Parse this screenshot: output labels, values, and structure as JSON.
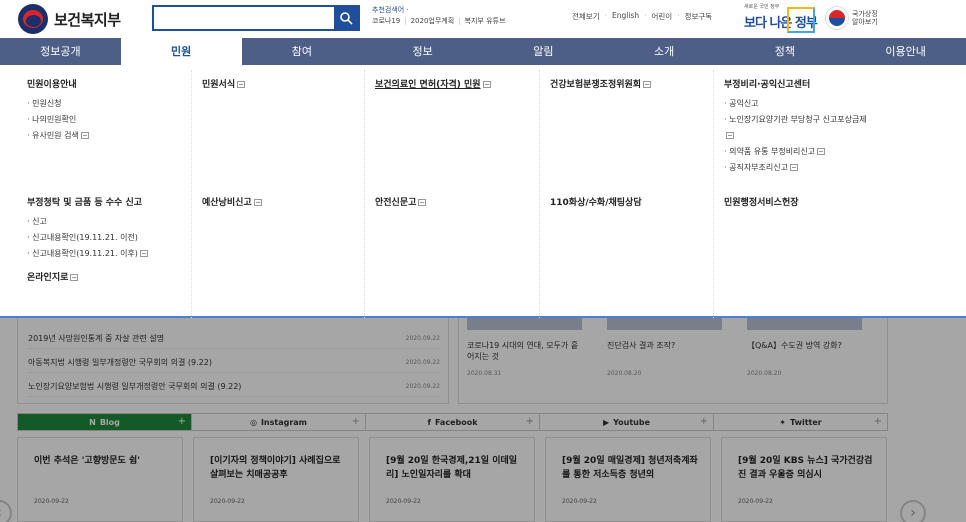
{
  "header": {
    "logo_text": "보건복지부",
    "search_placeholder": "",
    "rec_title": "추천검색어",
    "rec_items": [
      "코로나19",
      "2020업무계획",
      "복지부 유튜브"
    ],
    "top_links": [
      "전체보기",
      "English",
      "어린이",
      "정보구독"
    ],
    "gov_small": "새로운 국민 정부",
    "gov_text": "보다 나은 정부",
    "state_text": [
      "국가상징",
      "알아보기"
    ]
  },
  "nav": [
    "정보공개",
    "민원",
    "참여",
    "정보",
    "알림",
    "소개",
    "정책",
    "이용안내"
  ],
  "mega": {
    "row1": [
      {
        "title": "민원이용안내",
        "items": [
          "민원신청",
          "나의민원확인",
          "유사민원 검색"
        ]
      },
      {
        "title": "민원서식",
        "items": []
      },
      {
        "title": "보건의료인 면허(자격) 민원",
        "items": []
      },
      {
        "title": "건강보험분쟁조정위원회",
        "items": []
      },
      {
        "title": "부정비리·공익신고센터",
        "items": [
          "공익신고",
          "노인장기요양기관 부당청구 신고포상금제",
          "의약품 유통 부정비리신고",
          "공직자부조리신고"
        ]
      }
    ],
    "row2": [
      {
        "title": "부정청탁 및 금품 등 수수 신고",
        "items": [
          "신고",
          "신고내용확인(19.11.21. 이전)",
          "신고내용확인(19.11.21. 이후)"
        ],
        "extra": "온라인지로"
      },
      {
        "title": "예산낭비신고",
        "items": []
      },
      {
        "title": "안전신문고",
        "items": []
      },
      {
        "title": "110화상/수화/채팅상담",
        "items": []
      },
      {
        "title": "민원행정서비스헌장",
        "items": []
      }
    ]
  },
  "news": [
    {
      "title": "2019년 사망원인통계 중 자살 관련 설명",
      "date": "2020.09.22"
    },
    {
      "title": "아동복지법 시행령 일부개정령안 국무회의 의결 (9.22)",
      "date": "2020.09.22"
    },
    {
      "title": "노인장기요양보험법 시행령 일부개정령안 국무회의 의결 (9.22)",
      "date": "2020.09.22"
    }
  ],
  "cards": [
    {
      "title": "코로나19 시대의 연대, 모두가 흩어지는 것",
      "date": "2020.08.31"
    },
    {
      "title": "진단검사 결과 조작?",
      "date": "2020.08.20"
    },
    {
      "title": "【Q&A】수도권 방역 강화?",
      "date": "2020.08.20"
    }
  ],
  "sns": [
    {
      "label": "Blog",
      "icon": "N"
    },
    {
      "label": "Instagram",
      "icon": "◎"
    },
    {
      "label": "Facebook",
      "icon": "f"
    },
    {
      "label": "Youtube",
      "icon": "▶"
    },
    {
      "label": "Twitter",
      "icon": "✦"
    }
  ],
  "posts": [
    {
      "title": "이번 추석은 '고향방문도 쉼'",
      "date": "2020-09-22"
    },
    {
      "title": "[이기자의 정책이야기] 사례집으로 살펴보는 치매공공후",
      "date": "2020-09-22"
    },
    {
      "title": "[9월 20일 한국경제,21일 이데일리] 노인일자리를 확대",
      "date": "2020-09-22"
    },
    {
      "title": "[9월 20일 매일경제] 청년저축계좌를 통한 저소득층 청년의",
      "date": "2020-09-22"
    },
    {
      "title": "[9월 20일 KBS 뉴스] 국가건강검진 결과 우울증 의심시",
      "date": "2020-09-22"
    }
  ],
  "colors": {
    "nav_bg": "#4d5f86",
    "brand": "#1e4e9c",
    "blog_green": "#1e8a3c"
  }
}
